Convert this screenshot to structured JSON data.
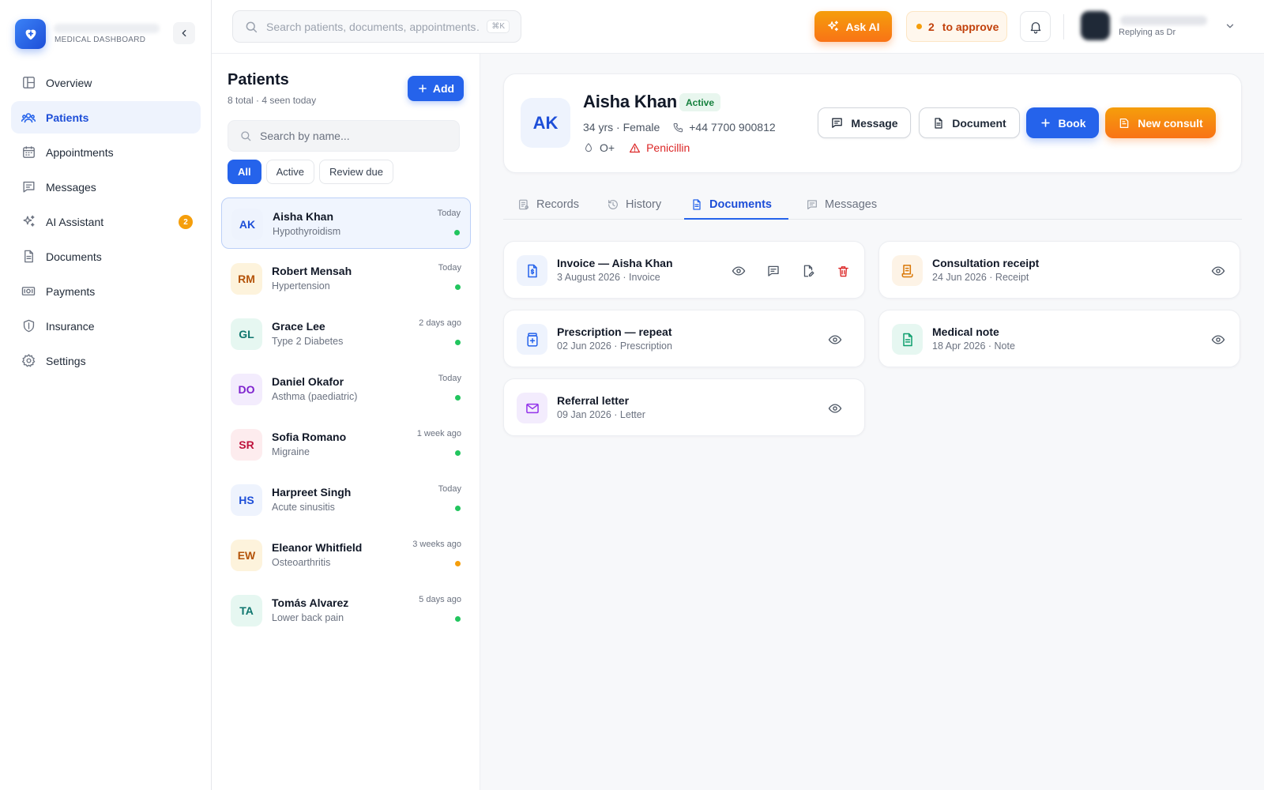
{
  "sidebar": {
    "brand_sub": "MEDICAL DASHBOARD",
    "items": [
      {
        "label": "Overview",
        "icon": "layout-icon"
      },
      {
        "label": "Patients",
        "icon": "users-icon",
        "active": true
      },
      {
        "label": "Appointments",
        "icon": "calendar-icon"
      },
      {
        "label": "Messages",
        "icon": "message-icon"
      },
      {
        "label": "AI Assistant",
        "icon": "sparkles-icon",
        "badge": "2"
      },
      {
        "label": "Documents",
        "icon": "document-icon"
      },
      {
        "label": "Payments",
        "icon": "banknote-icon"
      },
      {
        "label": "Insurance",
        "icon": "shield-icon"
      },
      {
        "label": "Settings",
        "icon": "gear-icon"
      }
    ]
  },
  "header": {
    "search_placeholder": "Search patients, documents, appointments…",
    "shortcut": "⌘K",
    "ask_ai": "Ask AI",
    "approve_count": "2",
    "approve_label": "to approve",
    "replying": "Replying as Dr"
  },
  "patients": {
    "title": "Patients",
    "subtitle": "8 total · 4 seen today",
    "add_label": "Add",
    "search_placeholder": "Search by name...",
    "filters": [
      "All",
      "Active",
      "Review due"
    ],
    "list": [
      {
        "initials": "AK",
        "name": "Aisha Khan",
        "condition": "Hypothyroidism",
        "when": "Today",
        "status_color": "#22c55e",
        "bg": "#eef3fd",
        "fg": "#1d4ed8"
      },
      {
        "initials": "RM",
        "name": "Robert Mensah",
        "condition": "Hypertension",
        "when": "Today",
        "status_color": "#22c55e",
        "bg": "#fdf3dc",
        "fg": "#b45309"
      },
      {
        "initials": "GL",
        "name": "Grace Lee",
        "condition": "Type 2 Diabetes",
        "when": "2 days ago",
        "status_color": "#22c55e",
        "bg": "#e6f7f1",
        "fg": "#0f766e"
      },
      {
        "initials": "DO",
        "name": "Daniel Okafor",
        "condition": "Asthma (paediatric)",
        "when": "Today",
        "status_color": "#22c55e",
        "bg": "#f3ecfd",
        "fg": "#7e22ce"
      },
      {
        "initials": "SR",
        "name": "Sofia Romano",
        "condition": "Migraine",
        "when": "1 week ago",
        "status_color": "#22c55e",
        "bg": "#fdecee",
        "fg": "#be123c"
      },
      {
        "initials": "HS",
        "name": "Harpreet Singh",
        "condition": "Acute sinusitis",
        "when": "Today",
        "status_color": "#22c55e",
        "bg": "#eef3fd",
        "fg": "#1d4ed8"
      },
      {
        "initials": "EW",
        "name": "Eleanor Whitfield",
        "condition": "Osteoarthritis",
        "when": "3 weeks ago",
        "status_color": "#f59e0b",
        "bg": "#fdf3dc",
        "fg": "#b45309"
      },
      {
        "initials": "TA",
        "name": "Tomás Alvarez",
        "condition": "Lower back pain",
        "when": "5 days ago",
        "status_color": "#22c55e",
        "bg": "#e6f7f1",
        "fg": "#0f766e"
      }
    ]
  },
  "patient": {
    "initials": "AK",
    "name": "Aisha Khan",
    "status": "Active",
    "age_sex": "34 yrs · Female",
    "phone": "+44 7700 900812",
    "blood": "O+",
    "allergy": "Penicillin",
    "actions": {
      "message": "Message",
      "document": "Document",
      "book": "Book",
      "consult": "New consult"
    }
  },
  "tabs": [
    "Records",
    "History",
    "Documents",
    "Messages"
  ],
  "documents": [
    {
      "title": "Invoice — Aisha Khan",
      "meta": "3 August 2026 · Invoice",
      "icon": "invoice-icon",
      "tint": "#eef3fd",
      "color": "#2563eb"
    },
    {
      "title": "Consultation receipt",
      "meta": "24 Jun 2026 · Receipt",
      "icon": "receipt-icon",
      "tint": "#fdf3e6",
      "color": "#d97706"
    },
    {
      "title": "Prescription — repeat",
      "meta": "02 Jun 2026 · Prescription",
      "icon": "prescription-icon",
      "tint": "#eef3fd",
      "color": "#2563eb"
    },
    {
      "title": "Medical note",
      "meta": "18 Apr 2026 · Note",
      "icon": "note-icon",
      "tint": "#e6f7f1",
      "color": "#0f9f6e"
    },
    {
      "title": "Referral letter",
      "meta": "09 Jan 2026 · Letter",
      "icon": "mail-icon",
      "tint": "#f3ecfd",
      "color": "#9333ea"
    }
  ]
}
